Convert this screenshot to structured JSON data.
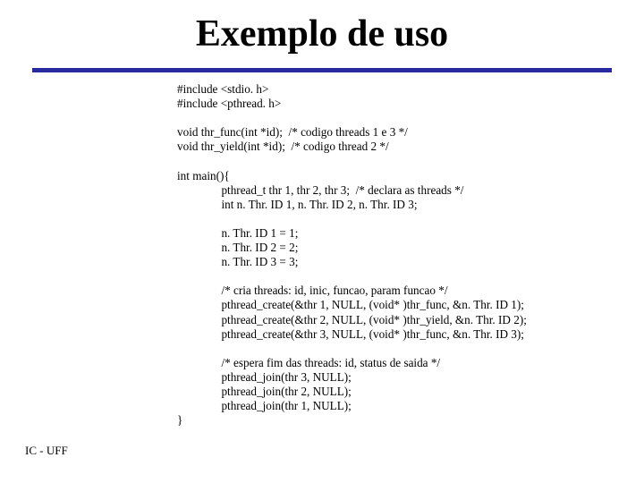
{
  "title": "Exemplo de uso",
  "footer": "IC - UFF",
  "code_lines": [
    "#include <stdio. h>",
    "#include <pthread. h>",
    "",
    "void thr_func(int *id);  /* codigo threads 1 e 3 */",
    "void thr_yield(int *id);  /* codigo thread 2 */",
    "",
    "int main(){",
    "               pthread_t thr 1, thr 2, thr 3;  /* declara as threads */",
    "               int n. Thr. ID 1, n. Thr. ID 2, n. Thr. ID 3;",
    "",
    "               n. Thr. ID 1 = 1;",
    "               n. Thr. ID 2 = 2;",
    "               n. Thr. ID 3 = 3;",
    "",
    "               /* cria threads: id, inic, funcao, param funcao */",
    "               pthread_create(&thr 1, NULL, (void* )thr_func, &n. Thr. ID 1);",
    "               pthread_create(&thr 2, NULL, (void* )thr_yield, &n. Thr. ID 2);",
    "               pthread_create(&thr 3, NULL, (void* )thr_func, &n. Thr. ID 3);",
    "",
    "               /* espera fim das threads: id, status de saida */",
    "               pthread_join(thr 3, NULL);",
    "               pthread_join(thr 2, NULL);",
    "               pthread_join(thr 1, NULL);",
    "}"
  ]
}
